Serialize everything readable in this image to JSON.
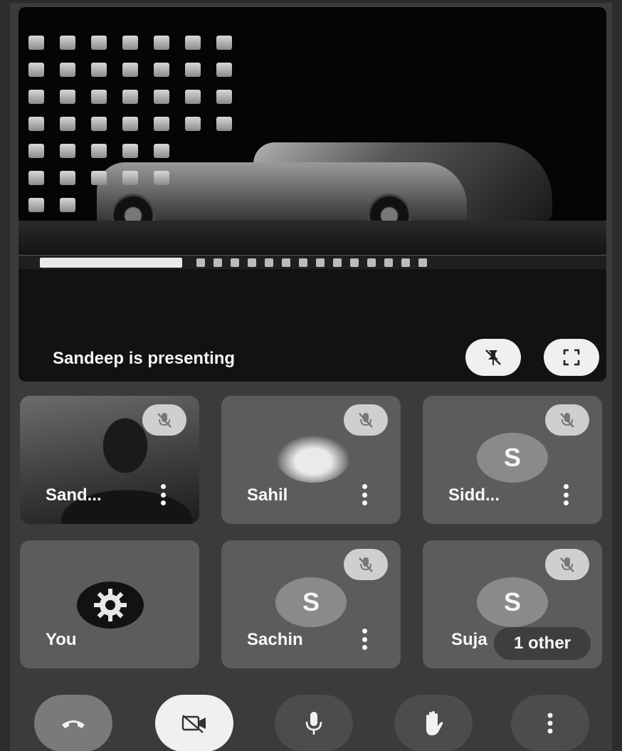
{
  "presentation": {
    "label": "Sandeep is presenting"
  },
  "participants": [
    {
      "name": "Sand...",
      "avatar": "camera-video",
      "muted": true,
      "has_menu": true
    },
    {
      "name": "Sahil",
      "avatar": "car-photo",
      "muted": true,
      "has_menu": true
    },
    {
      "name": "Sidd...",
      "avatar_letter": "S",
      "muted": true,
      "has_menu": true
    },
    {
      "name": "You",
      "avatar": "gear-logo",
      "muted": false,
      "has_menu": false
    },
    {
      "name": "Sachin",
      "avatar_letter": "S",
      "muted": true,
      "has_menu": true
    },
    {
      "name": "Suja",
      "avatar_letter": "S",
      "muted": true,
      "has_menu": false,
      "overlay": "1 other"
    }
  ],
  "controls": [
    {
      "icon": "end-call-icon"
    },
    {
      "icon": "camera-off-icon"
    },
    {
      "icon": "microphone-icon"
    },
    {
      "icon": "raise-hand-icon"
    },
    {
      "icon": "more-options-icon"
    }
  ],
  "colors": {
    "background": "#3b3b3b",
    "tile": "#5c5c5c",
    "end_call": "#7a7a7a",
    "light_button": "#f0f0f0"
  }
}
